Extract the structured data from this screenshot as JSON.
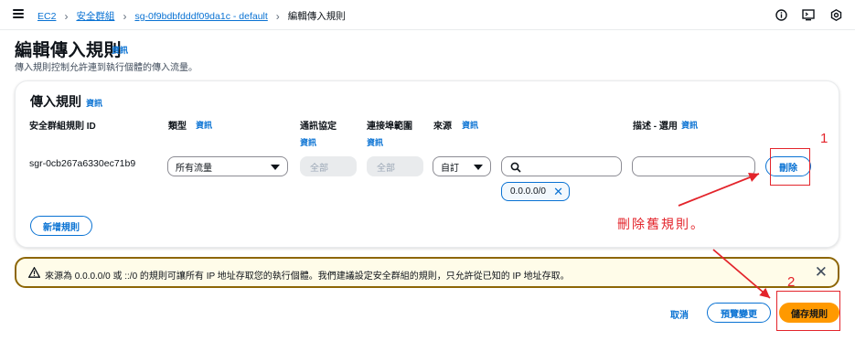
{
  "breadcrumb": {
    "items": [
      "EC2",
      "安全群組",
      "sg-0f9bdbfdddf09da1c - default"
    ],
    "current": "編輯傳入規則"
  },
  "top_icons": [
    "info-circle-icon",
    "cloudshell-icon",
    "settings-icon"
  ],
  "page": {
    "title": "編輯傳入規則",
    "info": "資訊",
    "description": "傳入規則控制允許連到執行個體的傳入流量。"
  },
  "panel": {
    "title": "傳入規則",
    "info": "資訊",
    "columns": {
      "rule_id": "安全群組規則 ID",
      "type": "類型",
      "protocol": "通訊協定",
      "port_range": "連接埠範圍",
      "source": "來源",
      "description": "描述 - 選用"
    },
    "info_label": "資訊",
    "rule": {
      "id": "sgr-0cb267a6330ec71b9",
      "type": "所有流量",
      "protocol": "全部",
      "port_range": "全部",
      "source_type": "自訂",
      "source_search": "",
      "source_token": "0.0.0.0/0",
      "description": "",
      "delete_label": "刪除"
    },
    "add_rule_label": "新增規則"
  },
  "warning": {
    "text": "來源為 0.0.0.0/0 或 ::/0 的規則可讓所有 IP 地址存取您的執行個體。我們建議設定安全群組的規則，只允許從已知的 IP 地址存取。"
  },
  "footer": {
    "cancel": "取消",
    "preview": "預覽變更",
    "save": "儲存規則"
  },
  "annotations": {
    "num1": "1",
    "num2": "2",
    "text": "刪除舊規則。",
    "color": "#e3242b"
  },
  "colors": {
    "accent": "#0972d3",
    "primary_button": "#ff9900",
    "warning_border": "#8d6605",
    "warning_bg": "#fffce9"
  }
}
